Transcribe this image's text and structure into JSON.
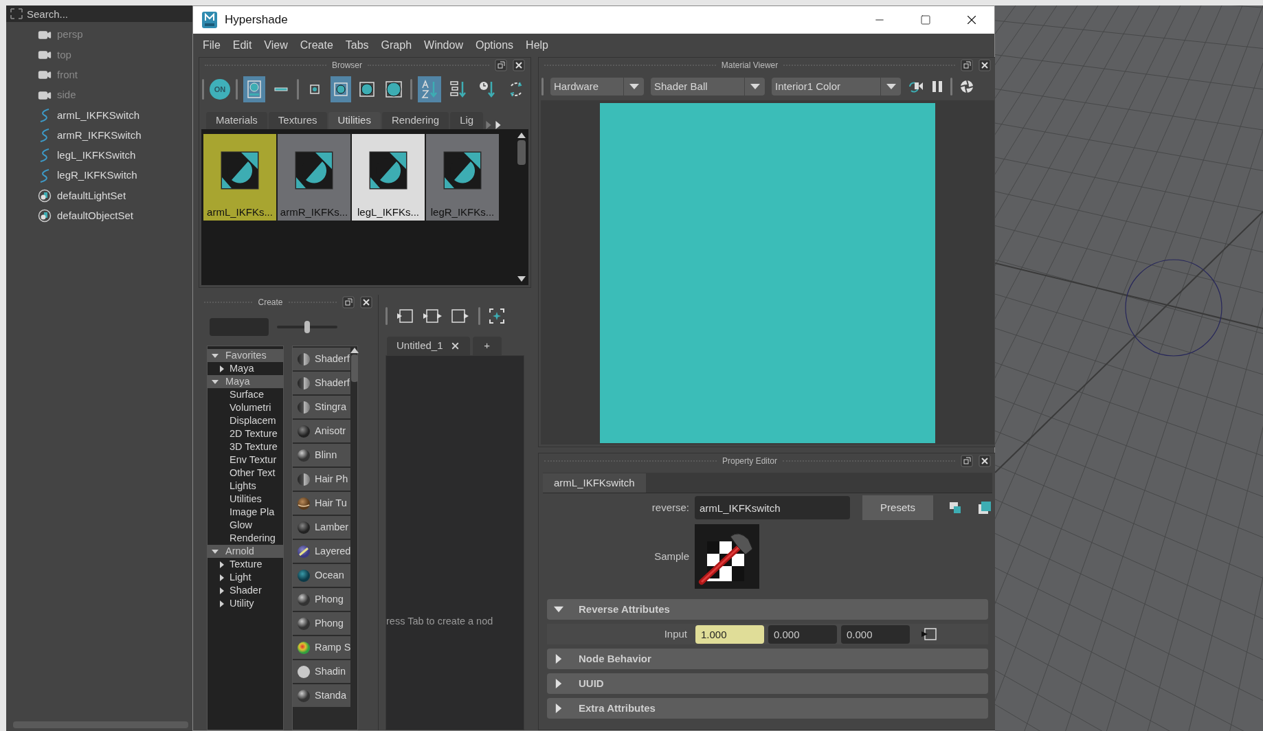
{
  "outliner": {
    "search_placeholder": "Search...",
    "items": [
      {
        "label": "persp",
        "kind": "camera",
        "hidden": true
      },
      {
        "label": "top",
        "kind": "camera",
        "hidden": true
      },
      {
        "label": "front",
        "kind": "camera",
        "hidden": true
      },
      {
        "label": "side",
        "kind": "camera",
        "hidden": true
      },
      {
        "label": "armL_IKFKSwitch",
        "kind": "curve",
        "hidden": false
      },
      {
        "label": "armR_IKFKSwitch",
        "kind": "curve",
        "hidden": false
      },
      {
        "label": "legL_IKFKSwitch",
        "kind": "curve",
        "hidden": false
      },
      {
        "label": "legR_IKFKSwitch",
        "kind": "curve",
        "hidden": false
      },
      {
        "label": "defaultLightSet",
        "kind": "set",
        "hidden": false
      },
      {
        "label": "defaultObjectSet",
        "kind": "set",
        "hidden": false
      }
    ]
  },
  "window": {
    "title": "Hypershade"
  },
  "menu": [
    "File",
    "Edit",
    "View",
    "Create",
    "Tabs",
    "Graph",
    "Window",
    "Options",
    "Help"
  ],
  "browser": {
    "title": "Browser",
    "toolbar": [
      {
        "kind": "on",
        "label": "ON",
        "selected": false
      },
      {
        "kind": "separator"
      },
      {
        "kind": "swatch-view",
        "selected": true
      },
      {
        "kind": "list-view",
        "selected": false
      },
      {
        "kind": "separator"
      },
      {
        "kind": "size-small",
        "selected": false
      },
      {
        "kind": "size-medium",
        "selected": true
      },
      {
        "kind": "size-large",
        "selected": false
      },
      {
        "kind": "size-xlarge",
        "selected": false
      },
      {
        "kind": "separator"
      },
      {
        "kind": "sort-name",
        "selected": true
      },
      {
        "kind": "sort-type",
        "selected": false
      },
      {
        "kind": "sort-time",
        "selected": false
      },
      {
        "kind": "refresh",
        "selected": false
      }
    ],
    "tabs": [
      {
        "label": "Materials",
        "selected": false
      },
      {
        "label": "Textures",
        "selected": false
      },
      {
        "label": "Utilities",
        "selected": true
      },
      {
        "label": "Rendering",
        "selected": false
      },
      {
        "label": "Lig",
        "selected": false
      }
    ],
    "swatches": [
      {
        "label": "armL_IKFKs...",
        "selected": true,
        "highlighted": false
      },
      {
        "label": "armR_IKFKs...",
        "selected": false,
        "highlighted": false
      },
      {
        "label": "legL_IKFKs...",
        "selected": false,
        "highlighted": true
      },
      {
        "label": "legR_IKFKs...",
        "selected": false,
        "highlighted": false
      }
    ]
  },
  "create": {
    "title": "Create",
    "slider": {
      "level": 0.5
    },
    "categories": [
      {
        "label": "Favorites",
        "expanded": true,
        "children": [
          {
            "label": "Maya",
            "expanded": false
          }
        ]
      },
      {
        "label": "Maya",
        "expanded": true,
        "children": [
          {
            "label": "Surface"
          },
          {
            "label": "Volumetri"
          },
          {
            "label": "Displacem"
          },
          {
            "label": "2D Texture"
          },
          {
            "label": "3D Texture"
          },
          {
            "label": "Env Textur"
          },
          {
            "label": "Other Text"
          },
          {
            "label": "Lights"
          },
          {
            "label": "Utilities"
          },
          {
            "label": "Image Pla"
          },
          {
            "label": "Glow"
          },
          {
            "label": "Rendering"
          }
        ]
      },
      {
        "label": "Arnold",
        "expanded": true,
        "children": [
          {
            "label": "Texture",
            "expanded": false
          },
          {
            "label": "Light",
            "expanded": false
          },
          {
            "label": "Shader",
            "expanded": false
          },
          {
            "label": "Utility",
            "expanded": false
          }
        ]
      }
    ],
    "nodes": [
      {
        "label": "Shaderf",
        "kind": "split"
      },
      {
        "label": "Shaderf",
        "kind": "split"
      },
      {
        "label": "Stingra",
        "kind": "split"
      },
      {
        "label": "Anisotr",
        "kind": "dark"
      },
      {
        "label": "Blinn",
        "kind": "gray"
      },
      {
        "label": "Hair Ph",
        "kind": "split"
      },
      {
        "label": "Hair Tu",
        "kind": "brown"
      },
      {
        "label": "Lamber",
        "kind": "dark"
      },
      {
        "label": "Layered",
        "kind": "layered"
      },
      {
        "label": "Ocean",
        "kind": "ocean"
      },
      {
        "label": "Phong",
        "kind": "gray"
      },
      {
        "label": "Phong",
        "kind": "gray"
      },
      {
        "label": "Ramp S",
        "kind": "ramp"
      },
      {
        "label": "Shadin",
        "kind": "white"
      },
      {
        "label": "Standa",
        "kind": "gray"
      }
    ]
  },
  "graph": {
    "tabs": [
      {
        "label": "Untitled_1",
        "selected": true
      }
    ],
    "add_tab": "+",
    "hint": "ress Tab to create a nod"
  },
  "material_viewer": {
    "title": "Material Viewer",
    "renderer": "Hardware",
    "geometry": "Shader Ball",
    "environment": "Interior1 Color"
  },
  "property_editor": {
    "title": "Property Editor",
    "tab": "armL_IKFKswitch",
    "type_label": "reverse:",
    "node_name": "armL_IKFKswitch",
    "presets": "Presets",
    "sample_label": "Sample",
    "sections": [
      {
        "label": "Reverse Attributes",
        "expanded": true
      },
      {
        "label": "Node Behavior",
        "expanded": false
      },
      {
        "label": "UUID",
        "expanded": false
      },
      {
        "label": "Extra Attributes",
        "expanded": false
      }
    ],
    "input": {
      "label": "Input",
      "values": [
        {
          "value": "1.000",
          "keyed": true
        },
        {
          "value": "0.000",
          "keyed": false
        },
        {
          "value": "0.000",
          "keyed": false
        }
      ]
    }
  }
}
